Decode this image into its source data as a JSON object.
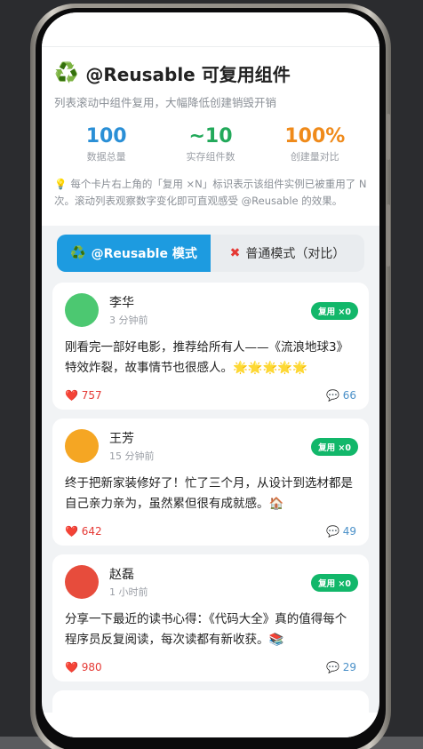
{
  "header": {
    "title_icon": "recycle-icon",
    "title": "@Reusable 可复用组件",
    "subtitle": "列表滚动中组件复用，大幅降低创建销毁开销",
    "stats": [
      {
        "value": "100",
        "label": "数据总量",
        "color": "#2a8fd6"
      },
      {
        "value": "~10",
        "label": "实存组件数",
        "color": "#22a95a"
      },
      {
        "value": "100%",
        "label": "创建量对比",
        "color": "#ef8a1a"
      }
    ],
    "hint_icon": "lightbulb-icon",
    "hint": "每个卡片右上角的「复用 ×N」标识表示该组件实例已被重用了 N 次。滚动列表观察数字变化即可直观感受 @Reusable 的效果。"
  },
  "tabs": [
    {
      "icon": "♻️",
      "label": "@Reusable 模式",
      "active": true
    },
    {
      "icon": "✖",
      "label": "普通模式（对比）",
      "active": false
    }
  ],
  "posts": [
    {
      "name": "李华",
      "time": "3 分钟前",
      "badge": "复用 ×0",
      "avatar_color": "#4cc871",
      "content": "刚看完一部好电影，推荐给所有人——《流浪地球3》特效炸裂，故事情节也很感人。🌟🌟🌟🌟🌟",
      "likes": "757",
      "comments": "66"
    },
    {
      "name": "王芳",
      "time": "15 分钟前",
      "badge": "复用 ×0",
      "avatar_color": "#f5a623",
      "content": "终于把新家装修好了！忙了三个月，从设计到选材都是自己亲力亲为，虽然累但很有成就感。🏠",
      "likes": "642",
      "comments": "49"
    },
    {
      "name": "赵磊",
      "time": "1 小时前",
      "badge": "复用 ×0",
      "avatar_color": "#e74c3c",
      "content": "分享一下最近的读书心得：《代码大全》真的值得每个程序员反复阅读，每次读都有新收获。📚",
      "likes": "980",
      "comments": "29"
    }
  ]
}
